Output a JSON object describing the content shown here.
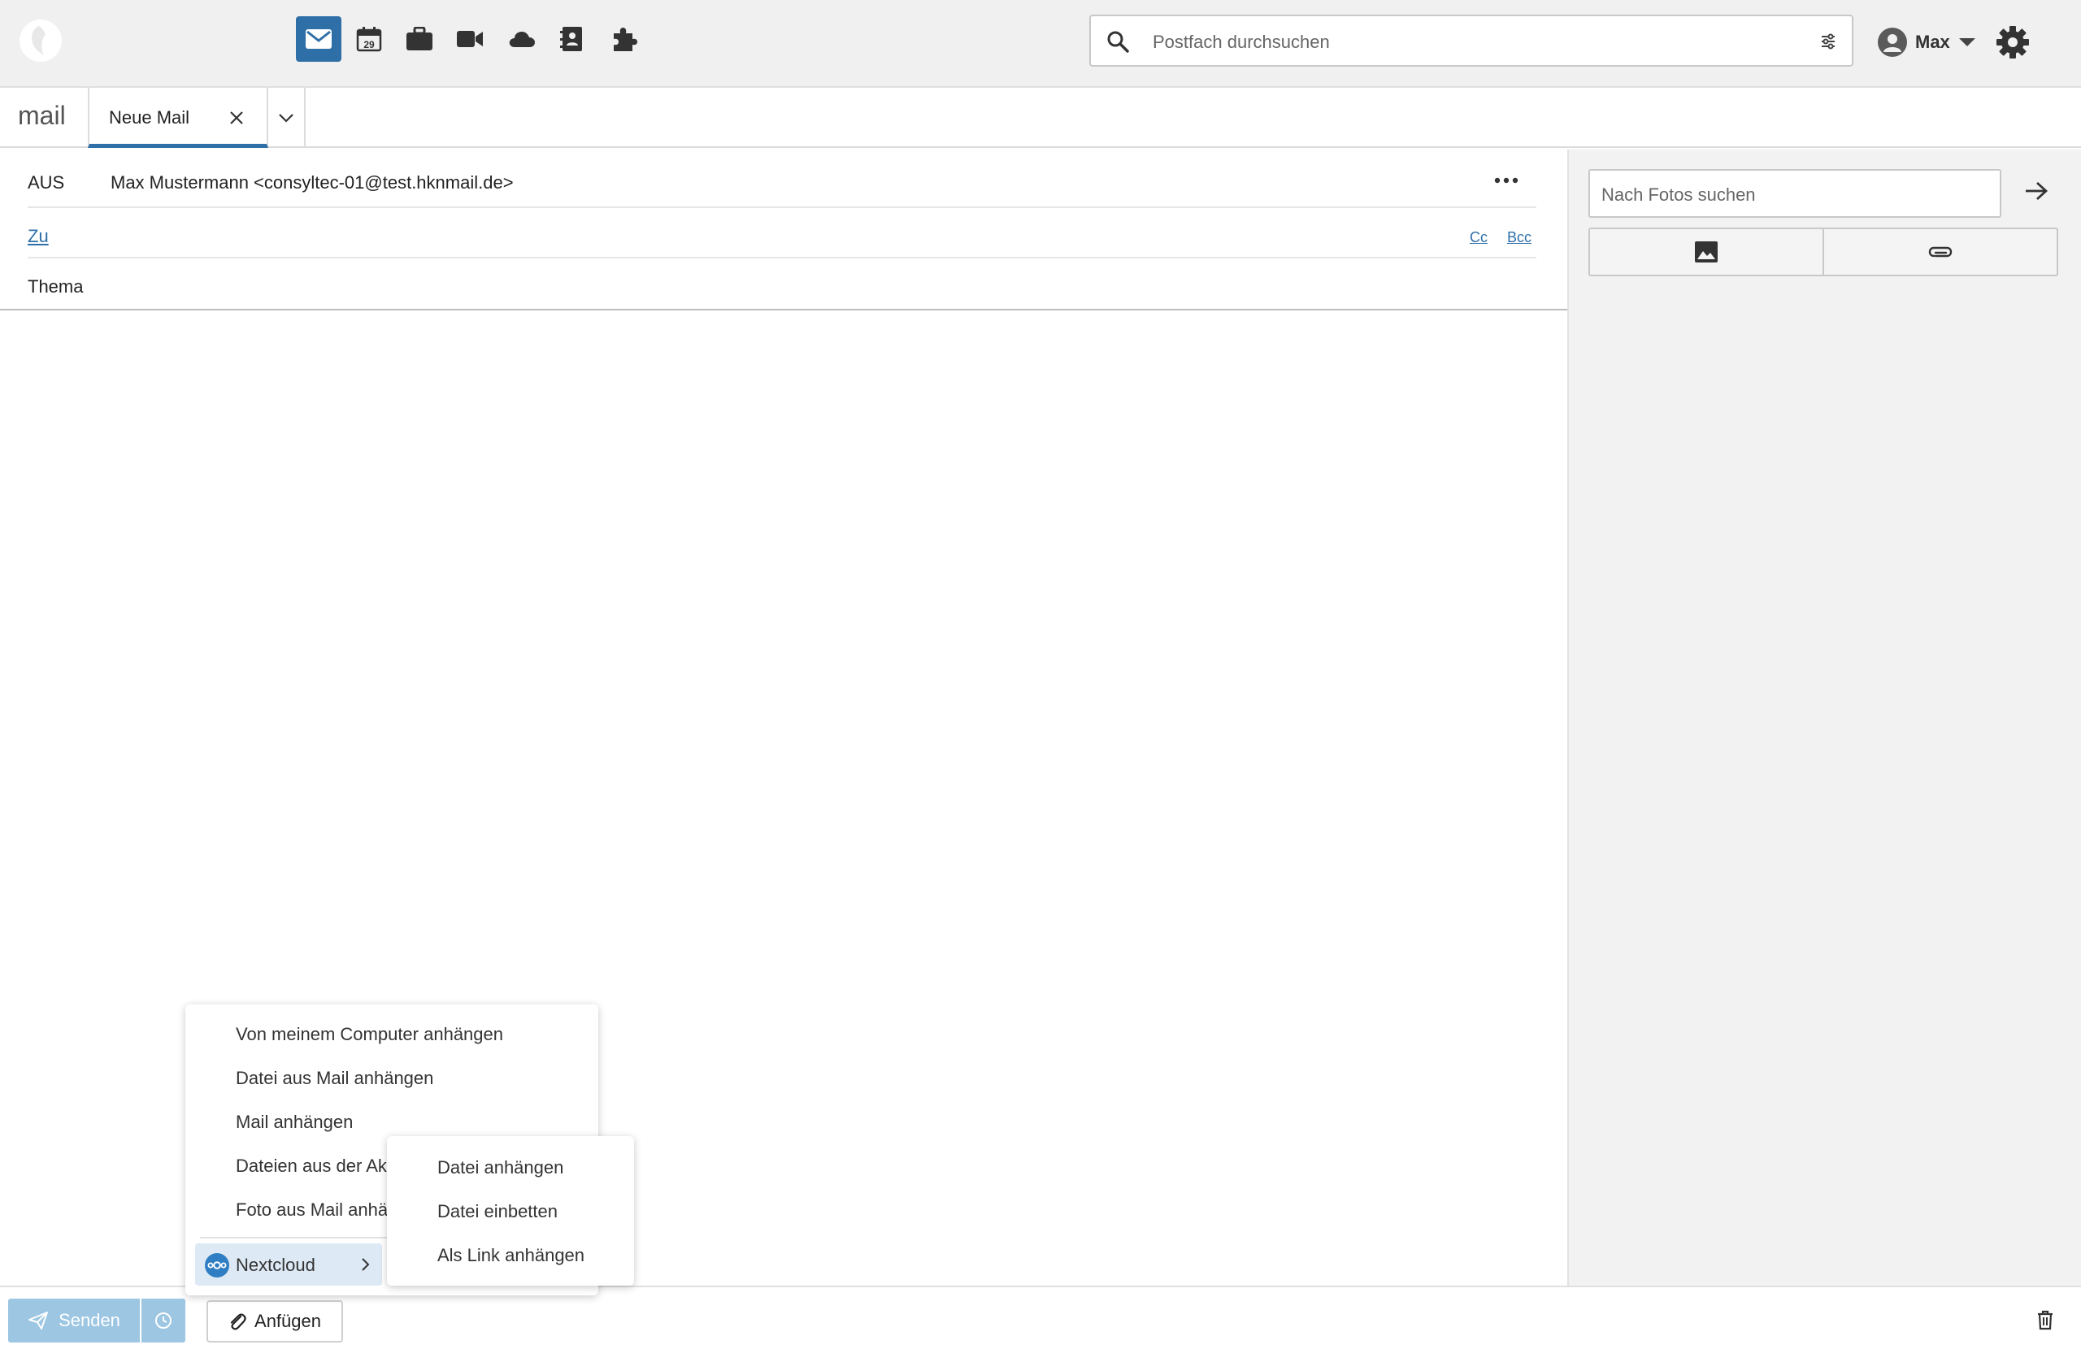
{
  "topbar": {
    "apps": [
      {
        "name": "mail-icon",
        "active": true
      },
      {
        "name": "calendar-icon",
        "active": false,
        "day": "29"
      },
      {
        "name": "briefcase-icon",
        "active": false
      },
      {
        "name": "video-icon",
        "active": false
      },
      {
        "name": "cloud-icon",
        "active": false
      },
      {
        "name": "contacts-icon",
        "active": false
      },
      {
        "name": "puzzle-icon",
        "active": false
      }
    ],
    "search_placeholder": "Postfach durchsuchen",
    "user_name": "Max"
  },
  "tabs": {
    "app_title": "mail",
    "active_tab": "Neue Mail"
  },
  "compose": {
    "from_label": "AUS",
    "from_value": "Max Mustermann <consyltec-01@test.hknmail.de>",
    "to_label": "Zu",
    "cc_label": "Cc",
    "bcc_label": "Bcc",
    "subject_label": "Thema"
  },
  "sidebar": {
    "photo_search_placeholder": "Nach Fotos suchen"
  },
  "bottombar": {
    "send_label": "Senden",
    "attach_label": "Anfügen"
  },
  "attach_menu": {
    "items": [
      "Von meinem Computer anhängen",
      "Datei aus Mail anhängen",
      "Mail anhängen",
      "Dateien aus der Ak",
      "Foto aus Mail anhä"
    ],
    "nextcloud_label": "Nextcloud"
  },
  "sub_menu": {
    "items": [
      "Datei anhängen",
      "Datei einbetten",
      "Als Link anhängen"
    ]
  },
  "colors": {
    "accent": "#2f6fa8",
    "send_disabled": "#9cc6e2",
    "menu_highlight": "#dde9f4"
  }
}
